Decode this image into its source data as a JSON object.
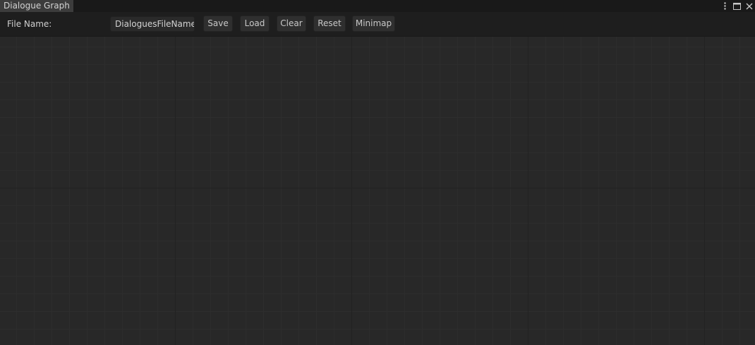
{
  "window": {
    "tab_title": "Dialogue Graph",
    "controls": [
      "more-vertical-icon",
      "maximize-icon",
      "close-icon"
    ]
  },
  "toolbar": {
    "file_name_label": "File Name:",
    "file_name_value": "DialoguesFileName",
    "save_label": "Save",
    "load_label": "Load",
    "clear_label": "Clear",
    "reset_label": "Reset",
    "minimap_label": "Minimap"
  },
  "colors": {
    "canvas": "#282828",
    "toolbar": "#1e1e1e",
    "tab_active": "#3c3c3c",
    "tab_bar": "#191919"
  }
}
